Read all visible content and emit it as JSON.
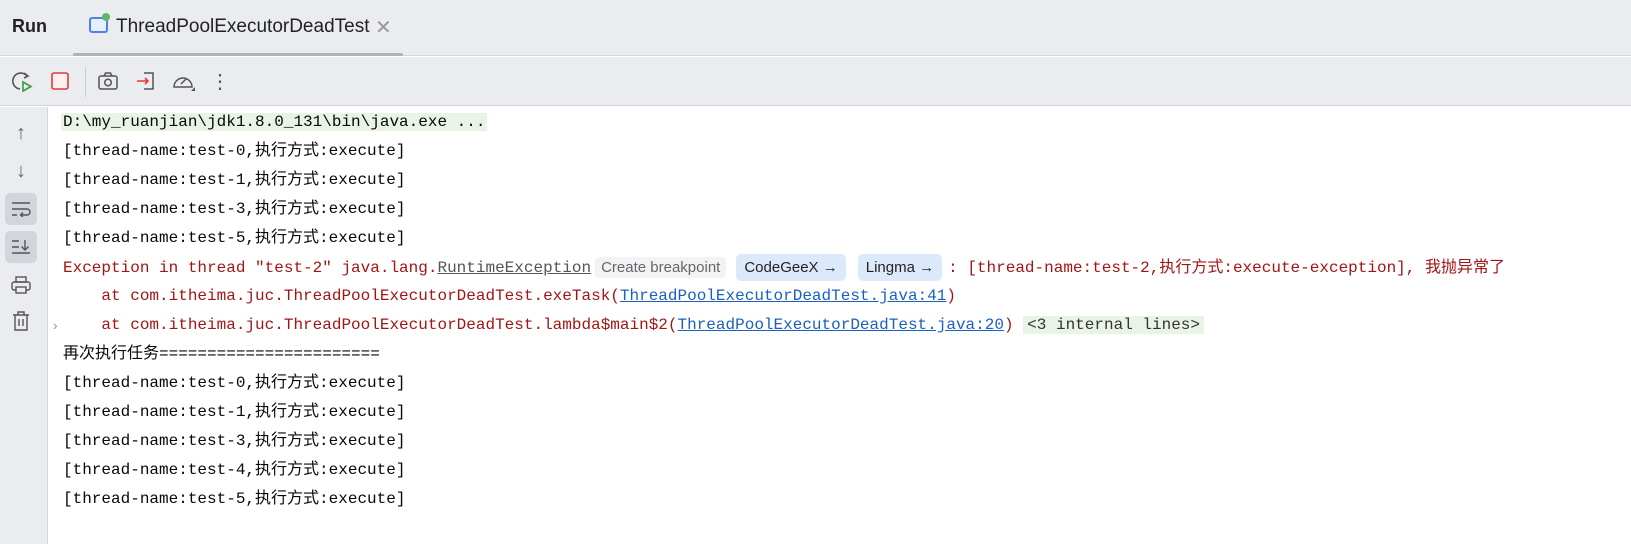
{
  "header": {
    "title": "Run",
    "tab_label": "ThreadPoolExecutorDeadTest"
  },
  "console": {
    "command": "D:\\my_ruanjian\\jdk1.8.0_131\\bin\\java.exe ...",
    "lines1": [
      "[thread-name:test-0,执行方式:execute]",
      "[thread-name:test-1,执行方式:execute]",
      "[thread-name:test-3,执行方式:execute]",
      "[thread-name:test-5,执行方式:execute]"
    ],
    "exception": {
      "prefix": "Exception in thread \"test-2\" java.lang.",
      "cls": "RuntimeException",
      "create_breakpoint": "Create breakpoint",
      "codegeex": "CodeGeeX →",
      "lingma": "Lingma →",
      "message": ": [thread-name:test-2,执行方式:execute-exception], 我抛异常了"
    },
    "trace1": {
      "prefix": "    at com.itheima.juc.ThreadPoolExecutorDeadTest.exeTask(",
      "link": "ThreadPoolExecutorDeadTest.java:41",
      "suffix": ")"
    },
    "trace2": {
      "prefix": "    at com.itheima.juc.ThreadPoolExecutorDeadTest.lambda$main$2(",
      "link": "ThreadPoolExecutorDeadTest.java:20",
      "suffix": ")",
      "internal": "<3 internal lines>"
    },
    "again": "再次执行任务=======================",
    "lines2": [
      "[thread-name:test-0,执行方式:execute]",
      "[thread-name:test-1,执行方式:execute]",
      "[thread-name:test-3,执行方式:execute]",
      "[thread-name:test-4,执行方式:execute]",
      "[thread-name:test-5,执行方式:execute]"
    ]
  }
}
